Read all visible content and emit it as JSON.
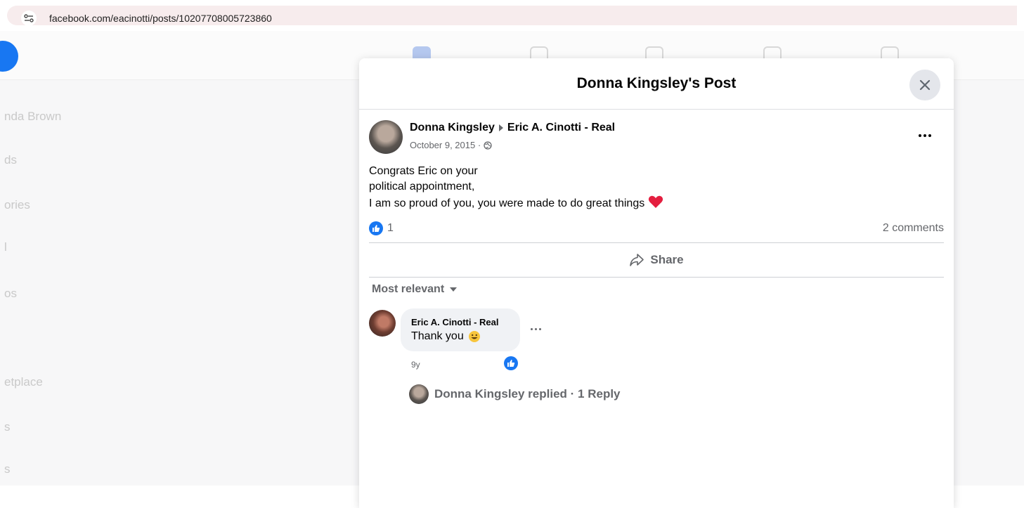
{
  "browser": {
    "url": "facebook.com/eacinotti/posts/10207708005723860"
  },
  "background": {
    "sidebar_items": [
      "nda Brown",
      "ds",
      "ories",
      "l",
      "os",
      "",
      "etplace",
      "s",
      "s"
    ]
  },
  "modal": {
    "title": "Donna Kingsley's Post",
    "post": {
      "author": "Donna Kingsley",
      "target": "Eric A. Cinotti - Real",
      "date": "October 9, 2015 · ",
      "text_lines": [
        "Congrats Eric on your",
        "political appointment,",
        "I am so proud of you, you were made to do great things "
      ],
      "reaction_count": "1",
      "comments_count": "2 comments",
      "share_label": "Share"
    },
    "sort_label": "Most relevant",
    "comment": {
      "author": "Eric A. Cinotti - Real",
      "text": "Thank you",
      "age": "9y"
    },
    "reply": {
      "label": "Donna Kingsley replied · 1 Reply"
    }
  },
  "colors": {
    "facebook_blue": "#1877f2",
    "secondary_text": "#65676b",
    "heart": "#e41e3f"
  }
}
